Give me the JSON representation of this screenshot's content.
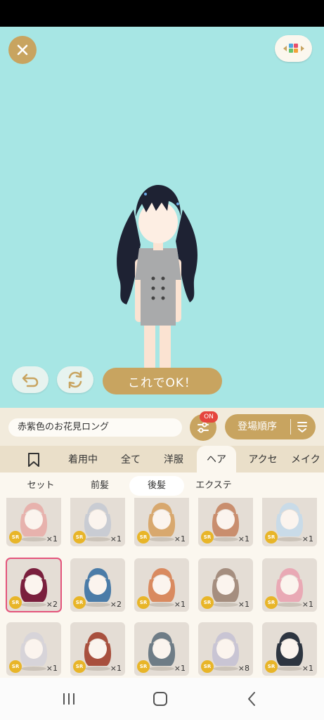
{
  "ok_button": "これでOK！",
  "item_name": "赤紫色のお花見ロング",
  "filter_badge": "ON",
  "sort_label": "登場順序",
  "category_tabs": [
    "着用中",
    "全て",
    "洋服",
    "ヘア",
    "アクセ",
    "メイク"
  ],
  "sub_tabs": [
    "セット",
    "前髪",
    "後髪",
    "エクステ"
  ],
  "items": [
    {
      "rarity": "SR",
      "qty": "×1",
      "hair": "#e7b2ad"
    },
    {
      "rarity": "SR",
      "qty": "×1",
      "hair": "#c9ccd3"
    },
    {
      "rarity": "SR",
      "qty": "×1",
      "hair": "#d8a86e"
    },
    {
      "rarity": "SR",
      "qty": "×1",
      "hair": "#c98e6e"
    },
    {
      "rarity": "SR",
      "qty": "×1",
      "hair": "#c9dbe8"
    },
    {
      "rarity": "SR",
      "qty": "×2",
      "hair": "#7a1f3d"
    },
    {
      "rarity": "SR",
      "qty": "×2",
      "hair": "#4b7ca8"
    },
    {
      "rarity": "SR",
      "qty": "×1",
      "hair": "#d98a5f"
    },
    {
      "rarity": "SR",
      "qty": "×1",
      "hair": "#a58e7f"
    },
    {
      "rarity": "SR",
      "qty": "×1",
      "hair": "#e9a9b5"
    },
    {
      "rarity": "SR",
      "qty": "×1",
      "hair": "#d7d4d9"
    },
    {
      "rarity": "SR",
      "qty": "×1",
      "hair": "#a8503e"
    },
    {
      "rarity": "SR",
      "qty": "×1",
      "hair": "#6e7c86"
    },
    {
      "rarity": "SR",
      "qty": "×8",
      "hair": "#c9c5d4"
    },
    {
      "rarity": "SR",
      "qty": "×1",
      "hair": "#2d3540"
    }
  ],
  "colors": {
    "stage": "#a7e6e4",
    "gold": "#c8a460",
    "badge_red": "#e5453d",
    "sr_yellow": "#e8b528",
    "selected_border": "#e4547b"
  },
  "icons": [
    "close-icon",
    "palette-icon",
    "undo-icon",
    "swap-icon",
    "filter-icon",
    "sort-icon",
    "bookmark-icon",
    "recent-apps-icon",
    "home-icon",
    "back-icon"
  ]
}
